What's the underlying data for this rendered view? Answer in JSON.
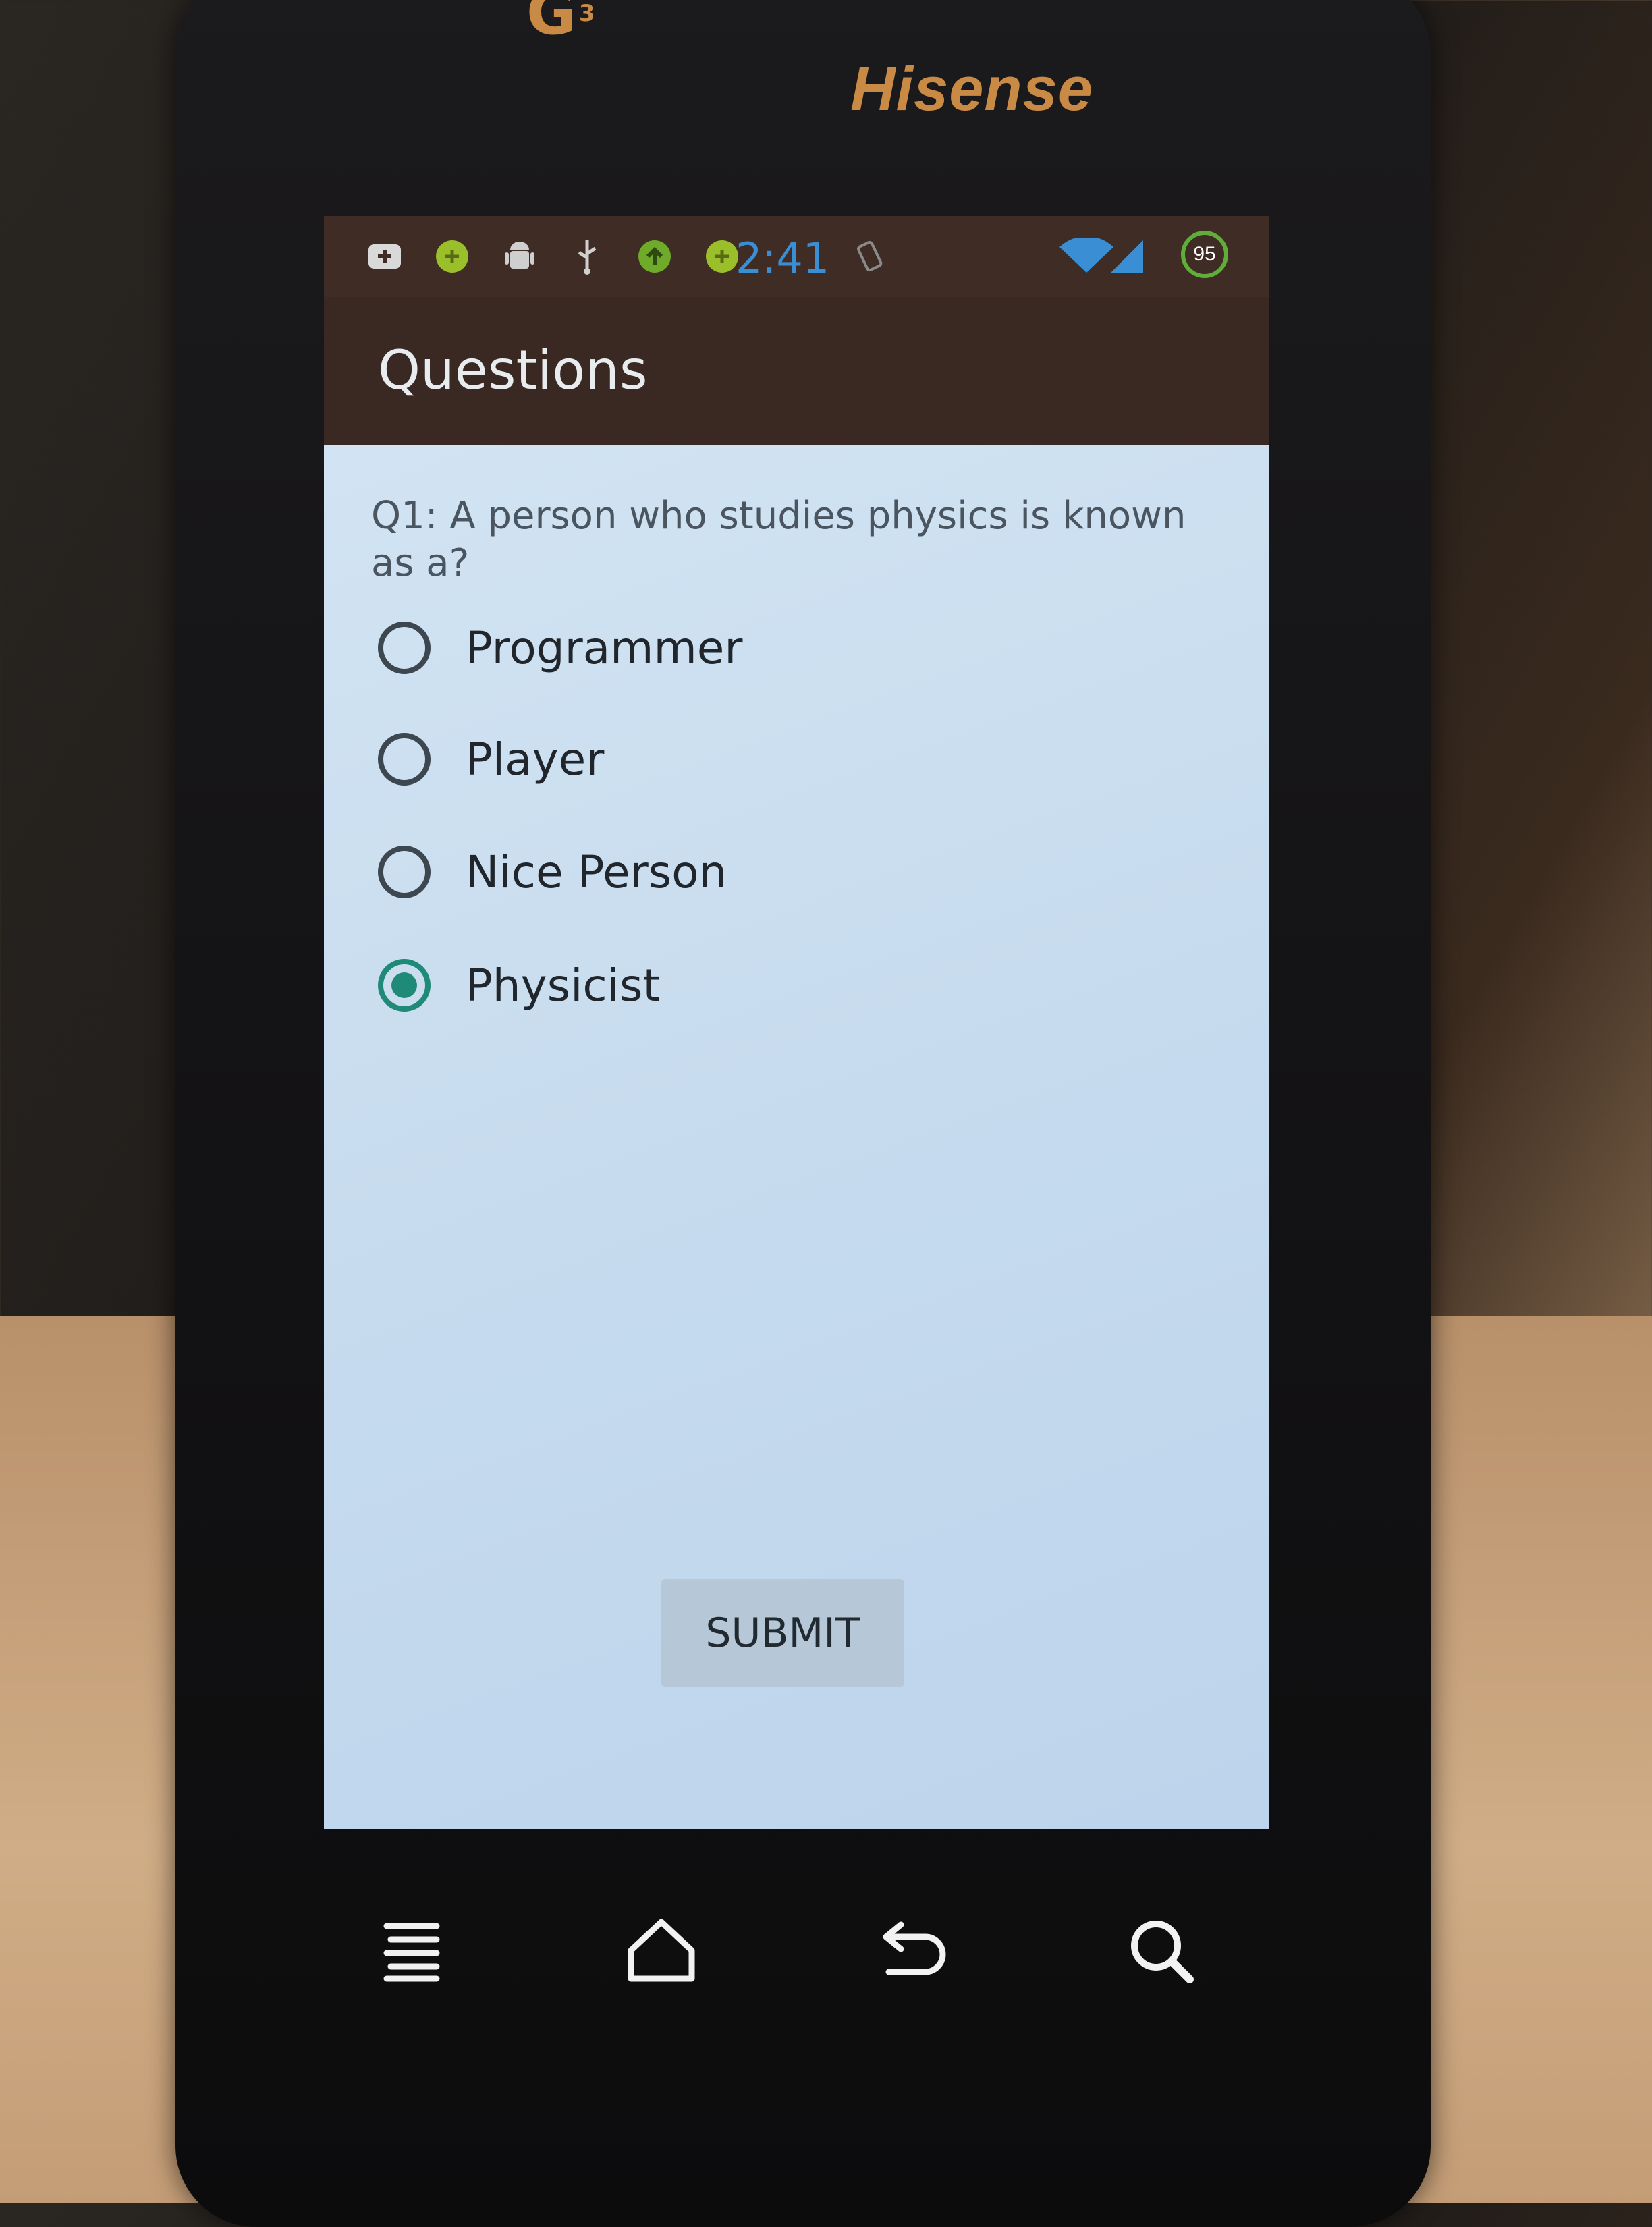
{
  "device": {
    "carrier_logo": "G",
    "carrier_logo_sup": "3",
    "brand": "Hisense"
  },
  "status_bar": {
    "time": "2:41",
    "battery_level": "95",
    "icons": [
      "plus-badge-icon",
      "green-notification-icon",
      "android-debug-icon",
      "usb-icon",
      "upload-icon",
      "green-notification-icon",
      "screen-rotate-icon",
      "wifi-icon",
      "signal-icon"
    ]
  },
  "action_bar": {
    "title": "Questions"
  },
  "quiz": {
    "question": "Q1: A person who studies physics is known as a?",
    "options": [
      {
        "label": "Programmer",
        "checked": false
      },
      {
        "label": "Player",
        "checked": false
      },
      {
        "label": "Nice Person",
        "checked": false
      },
      {
        "label": "Physicist",
        "checked": true
      }
    ],
    "submit_label": "SUBMIT"
  },
  "nav": {
    "icons": [
      "menu-icon",
      "home-icon",
      "back-icon",
      "search-icon"
    ]
  },
  "colors": {
    "accent": "#1f8a78",
    "brand": "#c98a46",
    "action_bar": "#3a2923",
    "screen_bg": "#c5dbee"
  }
}
